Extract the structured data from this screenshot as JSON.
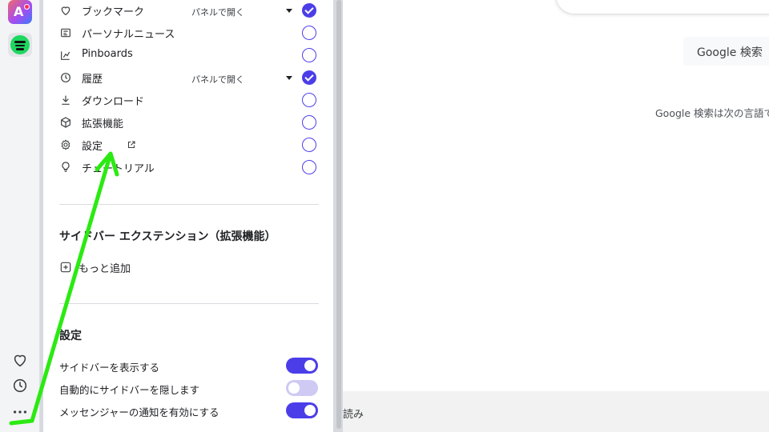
{
  "sidebar_panel": {
    "items": [
      {
        "label": "ブックマーク",
        "icon": "heart-icon",
        "dropdown": "パネルで開く",
        "checked": true
      },
      {
        "label": "パーソナルニュース",
        "icon": "news-icon",
        "checked": false
      },
      {
        "label": "Pinboards",
        "icon": "pinboard-icon",
        "checked": false
      },
      {
        "label": "履歴",
        "icon": "clock-icon",
        "dropdown": "パネルで開く",
        "checked": true
      },
      {
        "label": "ダウンロード",
        "icon": "download-icon",
        "checked": false
      },
      {
        "label": "拡張機能",
        "icon": "cube-icon",
        "checked": false
      },
      {
        "label": "設定",
        "icon": "gear-icon",
        "external": true,
        "checked": false
      },
      {
        "label": "チュートリアル",
        "icon": "lightbulb-icon",
        "checked": false
      }
    ],
    "extensions_section": {
      "title": "サイドバー エクステンション（拡張機能）",
      "add_more_label": "もっと追加"
    },
    "settings_section": {
      "title": "設定",
      "toggles": [
        {
          "label": "サイドバーを表示する",
          "on": true
        },
        {
          "label": "自動的にサイドバーを隠します",
          "on": false
        },
        {
          "label": "メッセンジャーの通知を有効にする",
          "on": true
        }
      ]
    }
  },
  "content": {
    "search_button": "Google 検索",
    "language_text": "Google 検索は次の言語で",
    "footer_text": "読み"
  },
  "colors": {
    "accent": "#4b3ee8",
    "arrow": "#2bea12",
    "toggle_off": "#cfcaf3"
  }
}
